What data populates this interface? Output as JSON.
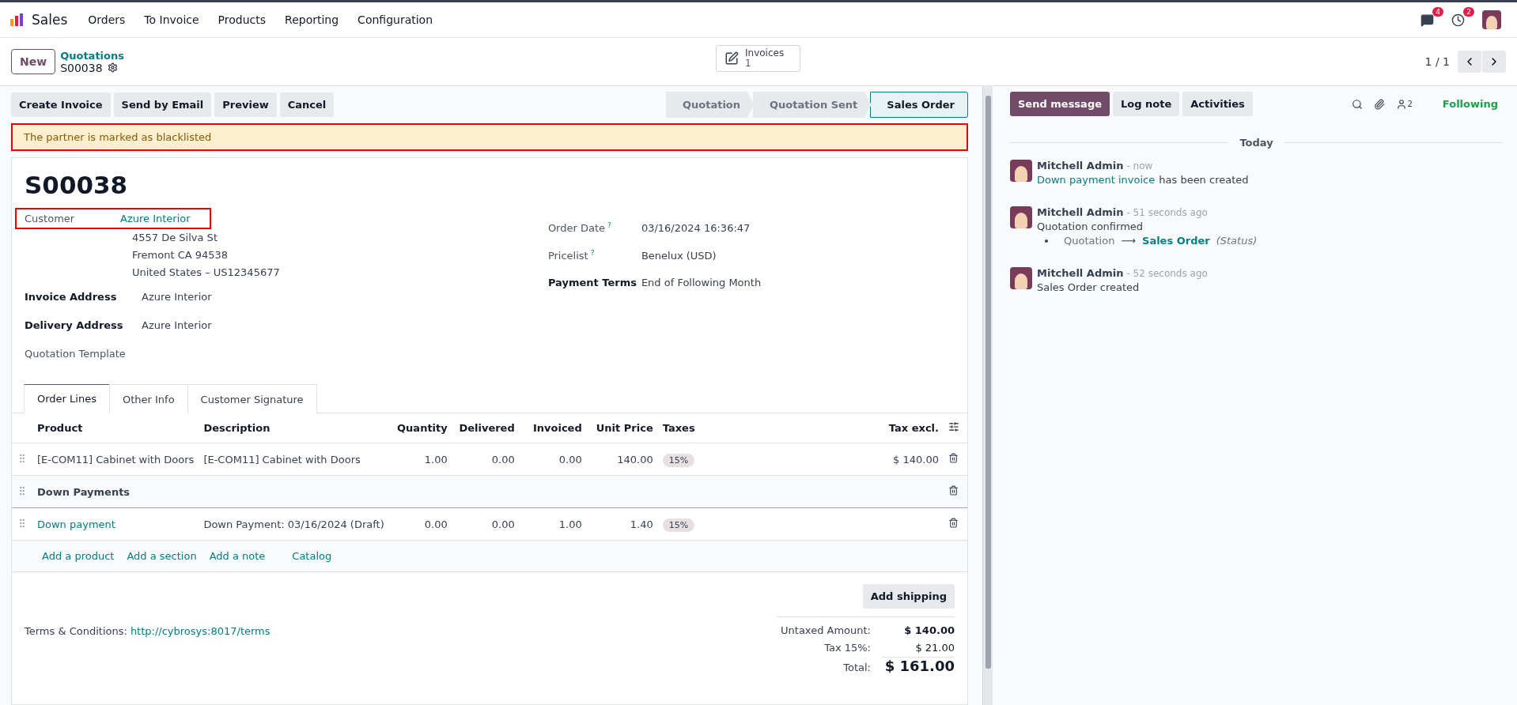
{
  "navbar": {
    "app": "Sales",
    "menu": [
      "Orders",
      "To Invoice",
      "Products",
      "Reporting",
      "Configuration"
    ],
    "messages_badge": "4",
    "activities_badge": "2"
  },
  "control_panel": {
    "new_button": "New",
    "breadcrumb": "Quotations",
    "record": "S00038",
    "smart_button": {
      "label": "Invoices",
      "count": "1"
    },
    "pager": "1 / 1"
  },
  "actions": [
    "Create Invoice",
    "Send by Email",
    "Preview",
    "Cancel"
  ],
  "statusbar": [
    {
      "label": "Quotation",
      "selected": false
    },
    {
      "label": "Quotation Sent",
      "selected": false
    },
    {
      "label": "Sales Order",
      "selected": true
    }
  ],
  "alert": {
    "text": "The partner is marked as blacklisted",
    "highlighted": true
  },
  "form": {
    "title": "S00038",
    "customer": {
      "label": "Customer",
      "name": "Azure Interior",
      "address": [
        "4557 De Silva St",
        "Fremont CA 94538",
        "United States – US12345677"
      ],
      "highlighted": true
    },
    "left_fields": [
      {
        "label": "Invoice Address",
        "value": "Azure Interior",
        "bold": true
      },
      {
        "label": "Delivery Address",
        "value": "Azure Interior",
        "bold": true
      },
      {
        "label": "Quotation Template",
        "bold": false
      }
    ],
    "right_fields": [
      {
        "label": "Order Date",
        "value": "03/16/2024 16:36:47",
        "help": "?",
        "bold": false
      },
      {
        "label": "Pricelist",
        "value": "Benelux (USD)",
        "help": "?",
        "bold": false
      },
      {
        "label": "Payment Terms",
        "value": "End of Following Month",
        "bold": true
      }
    ]
  },
  "tabs": [
    {
      "label": "Order Lines",
      "selected": true
    },
    {
      "label": "Other Info",
      "selected": false
    },
    {
      "label": "Customer Signature",
      "selected": false
    }
  ],
  "table": {
    "columns": [
      "Product",
      "Description",
      "Quantity",
      "Delivered",
      "Invoiced",
      "Unit Price",
      "Taxes",
      "Tax excl."
    ],
    "rows": [
      {
        "kind": "line",
        "product": "[E-COM11] Cabinet with Doors",
        "description": "[E-COM11] Cabinet with Doors",
        "quantity": "1.00",
        "delivered": "0.00",
        "invoiced": "0.00",
        "unit_price": "140.00",
        "taxes": "15%",
        "subtotal": "$ 140.00",
        "link": false
      },
      {
        "kind": "section",
        "product": "Down Payments"
      },
      {
        "kind": "line",
        "product": "Down payment",
        "description": "Down Payment: 03/16/2024 (Draft)",
        "quantity": "0.00",
        "delivered": "0.00",
        "invoiced": "1.00",
        "unit_price": "1.40",
        "taxes": "15%",
        "link": true
      }
    ],
    "add_links": [
      "Add a product",
      "Add a section",
      "Add a note",
      "Catalog"
    ]
  },
  "add_shipping": "Add shipping",
  "terms": {
    "label": "Terms & Conditions:",
    "link": "http://cybrosys:8017/terms"
  },
  "totals": [
    {
      "label": "Untaxed Amount:",
      "value": "$ 140.00",
      "kind": "sub"
    },
    {
      "label": "Tax 15%:",
      "value": "$ 21.00",
      "kind": "tax"
    },
    {
      "label": "Total:",
      "value": "$ 161.00",
      "kind": "total"
    }
  ],
  "chatter": {
    "buttons": [
      {
        "label": "Send message",
        "selected": true
      },
      {
        "label": "Log note",
        "selected": false
      },
      {
        "label": "Activities",
        "selected": false
      }
    ],
    "followers": "2",
    "following": "Following",
    "divider": "Today",
    "messages": [
      {
        "author": "Mitchell Admin",
        "time": "- now",
        "link": "Down payment invoice",
        "body": "has been created"
      },
      {
        "author": "Mitchell Admin",
        "time": "- 51 seconds ago",
        "body": "Quotation confirmed",
        "tracking": {
          "old": "Quotation",
          "arrow": "⟶",
          "new": "Sales Order",
          "field": "(Status)"
        }
      },
      {
        "author": "Mitchell Admin",
        "time": "- 52 seconds ago",
        "body": "Sales Order created"
      }
    ]
  }
}
